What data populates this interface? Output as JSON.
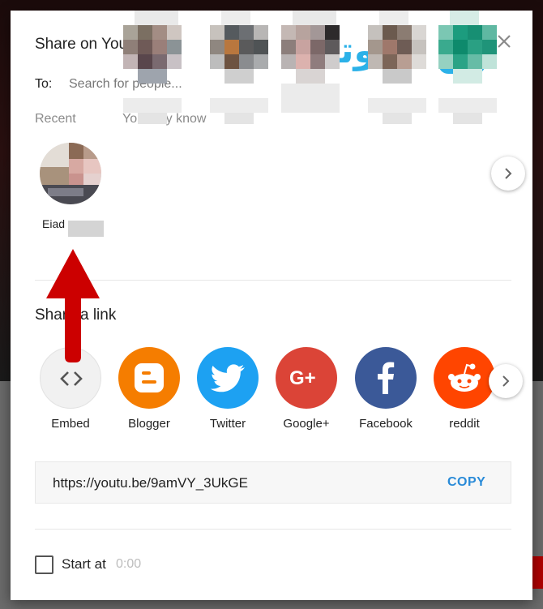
{
  "dialog": {
    "title": "Share on YouTube",
    "logo_text": "نيوتك"
  },
  "to": {
    "label": "To:",
    "placeholder": "Search for people..."
  },
  "people": {
    "recent_label": "Recent",
    "may_know_label": "You may know",
    "recent": [
      {
        "name": "Eiad"
      }
    ]
  },
  "share_link": {
    "heading": "Share a link",
    "targets": [
      {
        "label": "Embed",
        "icon": "code-icon",
        "color": "#f1f1f1"
      },
      {
        "label": "Blogger",
        "icon": "blogger-icon",
        "color": "#f57d00"
      },
      {
        "label": "Twitter",
        "icon": "twitter-icon",
        "color": "#1da1f2"
      },
      {
        "label": "Google+",
        "icon": "google-plus-icon",
        "color": "#db4437"
      },
      {
        "label": "Facebook",
        "icon": "facebook-icon",
        "color": "#3b5998"
      },
      {
        "label": "reddit",
        "icon": "reddit-icon",
        "color": "#ff4500"
      }
    ]
  },
  "url_box": {
    "url": "https://youtu.be/9amVY_3UkGE",
    "copy_label": "COPY"
  },
  "start_at": {
    "label": "Start at",
    "time": "0:00",
    "checked": false
  },
  "colors": {
    "accent_blue": "#2a8bd8",
    "annotation_red": "#cc0000"
  }
}
